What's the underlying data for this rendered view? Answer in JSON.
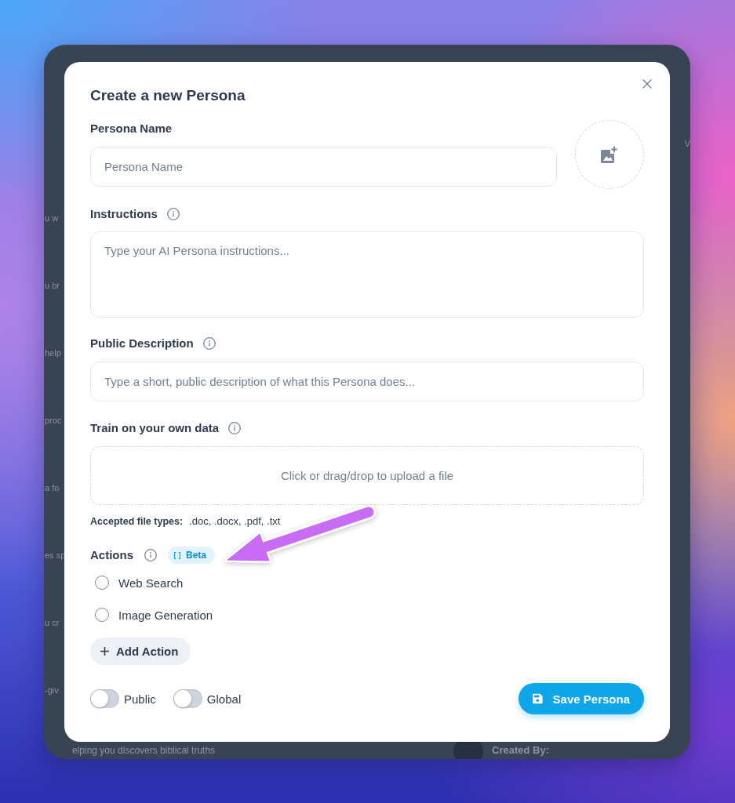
{
  "backdrop": {
    "left_fragments": [
      "u w",
      "u br",
      "help",
      "proc",
      "a fo",
      "es sp",
      "u cr",
      "-giv"
    ],
    "right_fragment": "V",
    "bottom_text": "elping you discovers biblical truths",
    "bottom_author_label": "Created By:"
  },
  "dialog": {
    "title": "Create a new Persona",
    "name_field": {
      "label": "Persona Name",
      "placeholder": "Persona Name"
    },
    "instructions": {
      "label": "Instructions",
      "placeholder": "Type your AI Persona instructions..."
    },
    "public_description": {
      "label": "Public Description",
      "placeholder": "Type a short, public description of what this Persona does..."
    },
    "training": {
      "label": "Train on your own data",
      "dropzone_text": "Click or drag/drop to upload a file",
      "accepted_label": "Accepted file types:",
      "accepted_types": ".doc, .docx, .pdf, .txt"
    },
    "actions": {
      "label": "Actions",
      "tag": "Beta",
      "options": [
        {
          "label": "Web Search",
          "checked": false
        },
        {
          "label": "Image Generation",
          "checked": false
        }
      ],
      "add_button": "Add Action"
    },
    "toggles": [
      {
        "label": "Public",
        "on": false
      },
      {
        "label": "Global",
        "on": false
      }
    ],
    "save_button": "Save Persona"
  }
}
